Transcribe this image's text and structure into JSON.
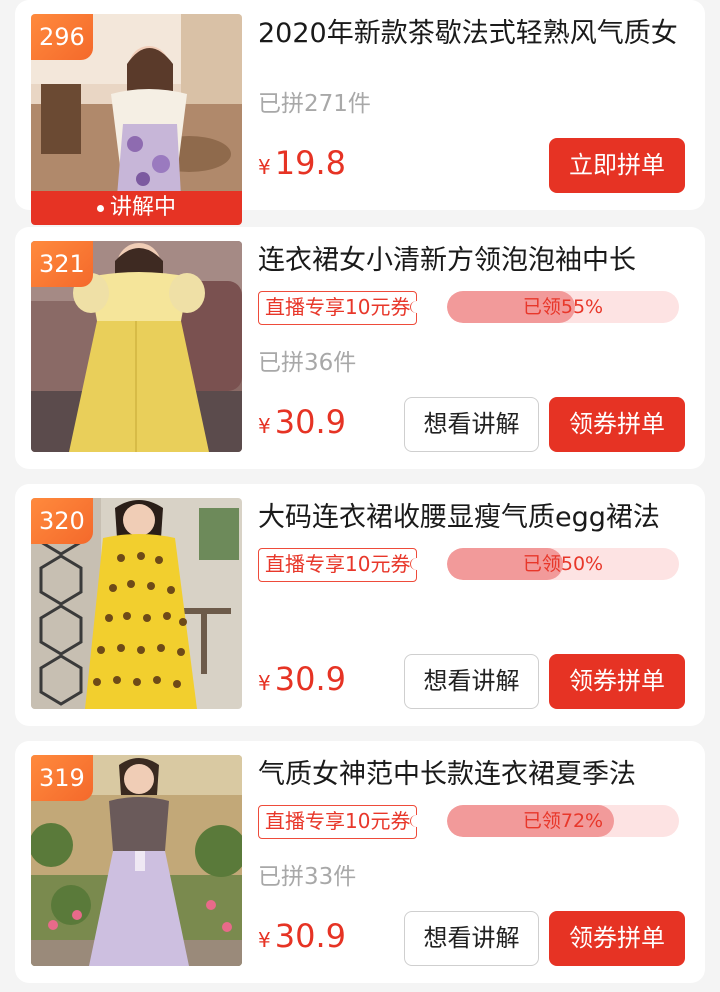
{
  "products": [
    {
      "rank": "296",
      "title": "2020年新款茶歇法式轻熟风气质女",
      "live_label": "讲解中",
      "sold": "已拼271件",
      "currency": "¥",
      "price": "19.8",
      "buy_label": "立即拼单"
    },
    {
      "rank": "321",
      "title": "连衣裙女小清新方领泡泡袖中长",
      "coupon": "直播专享10元券",
      "claimed_text": "已领55%",
      "claimed_percent": 55,
      "sold": "已拼36件",
      "currency": "¥",
      "price": "30.9",
      "explain_label": "想看讲解",
      "buy_label": "领券拼单"
    },
    {
      "rank": "320",
      "title": "大码连衣裙收腰显瘦气质egg裙法",
      "coupon": "直播专享10元券",
      "claimed_text": "已领50%",
      "claimed_percent": 50,
      "currency": "¥",
      "price": "30.9",
      "explain_label": "想看讲解",
      "buy_label": "领券拼单"
    },
    {
      "rank": "319",
      "title": "气质女神范中长款连衣裙夏季法",
      "coupon": "直播专享10元券",
      "claimed_text": "已领72%",
      "claimed_percent": 72,
      "sold": "已拼33件",
      "currency": "¥",
      "price": "30.9",
      "explain_label": "想看讲解",
      "buy_label": "领券拼单"
    }
  ],
  "colors": {
    "accent_red": "#e63324",
    "rank_orange": "#f4692b",
    "progress_fill": "#f29a9a",
    "progress_track": "#fde3e3"
  },
  "icons": {
    "live_dot": "live-dot-icon"
  }
}
